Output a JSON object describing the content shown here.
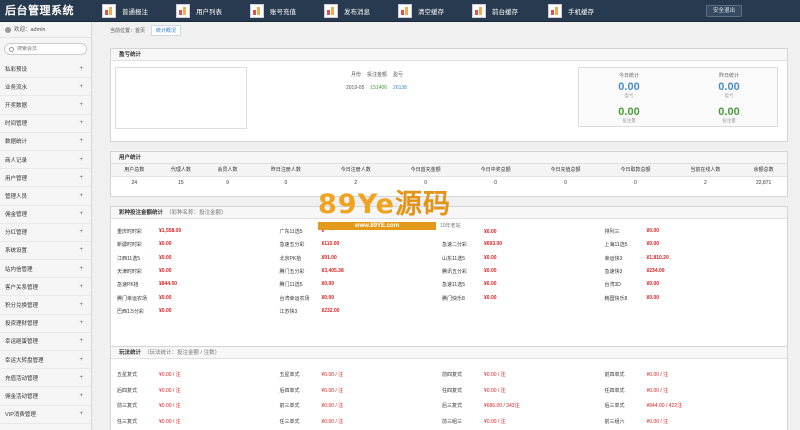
{
  "app": {
    "title": "后台管理系统"
  },
  "nav": [
    {
      "label": "普通报注",
      "icon": "chart-icon"
    },
    {
      "label": "用户列表",
      "icon": "chart-icon"
    },
    {
      "label": "账号充值",
      "icon": "chart-icon"
    },
    {
      "label": "发布消息",
      "icon": "chart-icon"
    },
    {
      "label": "清空缓存",
      "icon": "chart-icon"
    },
    {
      "label": "前台缓存",
      "icon": "chart-icon"
    },
    {
      "label": "手机缓存",
      "icon": "chart-icon"
    }
  ],
  "logout_label": "安全退出",
  "sidebar": {
    "welcome": "欢迎：admin",
    "search_placeholder": "搜索会员",
    "items": [
      "私彩预设",
      "业务流水",
      "开奖数据",
      "时间管理",
      "数据统计",
      "商人记录",
      "用户管理",
      "管理人员",
      "佣金管理",
      "分红管理",
      "系统设置",
      "站内信管理",
      "客户关系管理",
      "积分兑换管理",
      "投资理财管理",
      "幸运砸蛋管理",
      "幸运大转盘管理",
      "充值活动管理",
      "佣金活动管理",
      "VIP消费管理"
    ]
  },
  "breadcrumb": {
    "prefix": "当前位置：首页",
    "current": "统计概况"
  },
  "profit": {
    "title": "盈亏统计",
    "headers": [
      "月份",
      "投注金额",
      "盈亏"
    ],
    "row": {
      "month": "2019-05",
      "bet": "151406",
      "profit": "26138"
    },
    "today_label": "今日统计",
    "yesterday_label": "昨日统计",
    "today_profit": "0.00",
    "today_profit_cap": "盈亏",
    "today_bet": "0.00",
    "today_bet_cap": "投注量",
    "yest_profit": "0.00",
    "yest_profit_cap": "盈亏",
    "yest_bet": "0.00",
    "yest_bet_cap": "投注量"
  },
  "users": {
    "title": "用户统计",
    "headers": [
      "用户总数",
      "代理人数",
      "会员人数",
      "昨日注册人数",
      "今日注册人数",
      "今日首充金额",
      "今日中奖总额",
      "今日充值总额",
      "今日取款总额",
      "当前在线人数",
      "余额总数"
    ],
    "values": [
      "24",
      "15",
      "9",
      "0",
      "2",
      "0",
      "0",
      "0",
      "0",
      "2",
      "22,871"
    ]
  },
  "lottery": {
    "title": "彩种投注金额统计",
    "subtitle": "（彩种名称：投注金额）",
    "rows": [
      [
        [
          "重庆时时彩",
          "¥1,558.00"
        ],
        [
          "广东11选5",
          "¥"
        ],
        [
          "",
          "¥0.00"
        ],
        [
          "排列三",
          "¥0.00"
        ]
      ],
      [
        [
          "新疆时时彩",
          "¥0.00"
        ],
        [
          "急速五分彩",
          "¥110.00"
        ],
        [
          "急速二分彩",
          "¥693.00"
        ],
        [
          "上海11选5",
          "¥0.00"
        ]
      ],
      [
        [
          "江西11选5",
          "¥0.00"
        ],
        [
          "北京PK拾",
          "¥91.00"
        ],
        [
          "山东11选5",
          "¥0.00"
        ],
        [
          "幸运快3",
          "¥1,810.20"
        ]
      ],
      [
        [
          "天津时时彩",
          "¥0.00"
        ],
        [
          "腾门五分彩",
          "¥3,405.38"
        ],
        [
          "腾讯五分彩",
          "¥0.00"
        ],
        [
          "急速快3",
          "¥234.00"
        ]
      ],
      [
        [
          "急速PK拾",
          "¥844.00"
        ],
        [
          "腾门11选5",
          "¥0.00"
        ],
        [
          "急速11选5",
          "¥0.00"
        ],
        [
          "台湾3D",
          "¥0.00"
        ]
      ],
      [
        [
          "腾门幸运农场",
          "¥0.00"
        ],
        [
          "台湾幸运农场",
          "¥0.00"
        ],
        [
          "腾门快乐8",
          "¥0.00"
        ],
        [
          "韩国快乐8",
          "¥0.00"
        ]
      ],
      [
        [
          "巴西1.5分彩",
          "¥0.00"
        ],
        [
          "江苏快3",
          "¥232.00"
        ],
        [
          "",
          ""
        ],
        [
          "",
          ""
        ]
      ]
    ]
  },
  "play": {
    "title": "玩法统计",
    "subtitle": "（玩法统计：投注金额 / 注数）",
    "rows": [
      [
        [
          "五星复式",
          "¥0.00 / 注"
        ],
        [
          "五星单式",
          "¥0.00 / 注"
        ],
        [
          "前四复式",
          "¥0.00 / 注"
        ],
        [
          "前四单式",
          "¥0.00 / 注"
        ]
      ],
      [
        [
          "后四复式",
          "¥0.00 / 注"
        ],
        [
          "后四单式",
          "¥0.00 / 注"
        ],
        [
          "任四复式",
          "¥0.00 / 注"
        ],
        [
          "任四单式",
          "¥0.00 / 注"
        ]
      ],
      [
        [
          "前三复式",
          "¥0.00 / 注"
        ],
        [
          "前三单式",
          "¥0.00 / 注"
        ],
        [
          "后三复式",
          "¥686.00 / 343注"
        ],
        [
          "后三单式",
          "¥844.00 / 422注"
        ]
      ],
      [
        [
          "任三复式",
          "¥0.00 / 注"
        ],
        [
          "任三单式",
          "¥0.00 / 注"
        ],
        [
          "前三组三",
          "¥0.00 / 注"
        ],
        [
          "前三组六",
          "¥0.00 / 注"
        ]
      ]
    ]
  },
  "watermark": {
    "text": "89Ye",
    "cn": "源码",
    "url": "www.89YE.com",
    "tag": "10年老站"
  }
}
